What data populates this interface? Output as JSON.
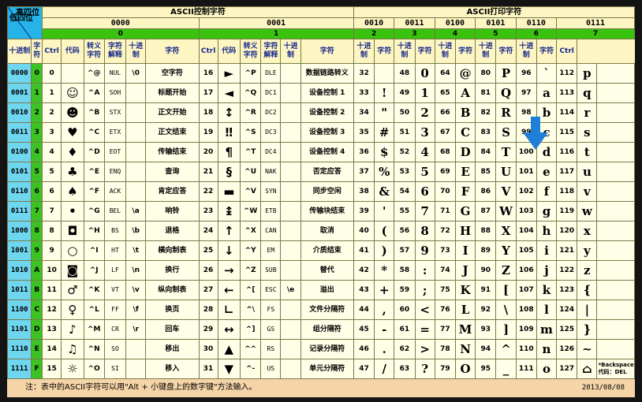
{
  "corner": {
    "top": "高四位",
    "bottom": "低四位"
  },
  "sections": {
    "control": "ASCII控制字符",
    "printable": "ASCII打印字符"
  },
  "high_bits": [
    "0000",
    "0001",
    "0010",
    "0011",
    "0100",
    "0101",
    "0110",
    "0111"
  ],
  "high_hex": [
    "0",
    "1",
    "2",
    "3",
    "4",
    "5",
    "6",
    "7"
  ],
  "col_headers": {
    "dec": "十进制",
    "char": "字符",
    "ctrl": "Ctrl",
    "code": "代码",
    "esc": "转义字符",
    "desc": "字符解释",
    "ctrl_last": "Ctrl"
  },
  "rows": [
    {
      "bin": "0000",
      "hex": "0",
      "c0": {
        "dec": "0",
        "glyph": "",
        "ctrl": "^@",
        "code": "NUL",
        "esc": "\\0",
        "desc": "空字符"
      },
      "c1": {
        "dec": "16",
        "glyph": "►",
        "ctrl": "^P",
        "code": "DLE",
        "esc": "",
        "desc": "数据链路转义"
      },
      "p": [
        {
          "dec": "32",
          "ch": ""
        },
        {
          "dec": "48",
          "ch": "0"
        },
        {
          "dec": "64",
          "ch": "@"
        },
        {
          "dec": "80",
          "ch": "P"
        },
        {
          "dec": "96",
          "ch": "`"
        },
        {
          "dec": "112",
          "ch": "p"
        }
      ]
    },
    {
      "bin": "0001",
      "hex": "1",
      "c0": {
        "dec": "1",
        "glyph": "☺",
        "ctrl": "^A",
        "code": "SOH",
        "esc": "",
        "desc": "标题开始"
      },
      "c1": {
        "dec": "17",
        "glyph": "◄",
        "ctrl": "^Q",
        "code": "DC1",
        "esc": "",
        "desc": "设备控制 1"
      },
      "p": [
        {
          "dec": "33",
          "ch": "!"
        },
        {
          "dec": "49",
          "ch": "1"
        },
        {
          "dec": "65",
          "ch": "A"
        },
        {
          "dec": "81",
          "ch": "Q"
        },
        {
          "dec": "97",
          "ch": "a"
        },
        {
          "dec": "113",
          "ch": "q"
        }
      ]
    },
    {
      "bin": "0010",
      "hex": "2",
      "c0": {
        "dec": "2",
        "glyph": "☻",
        "ctrl": "^B",
        "code": "STX",
        "esc": "",
        "desc": "正文开始"
      },
      "c1": {
        "dec": "18",
        "glyph": "↕",
        "ctrl": "^R",
        "code": "DC2",
        "esc": "",
        "desc": "设备控制 2"
      },
      "p": [
        {
          "dec": "34",
          "ch": "\""
        },
        {
          "dec": "50",
          "ch": "2"
        },
        {
          "dec": "66",
          "ch": "B"
        },
        {
          "dec": "82",
          "ch": "R"
        },
        {
          "dec": "98",
          "ch": "b"
        },
        {
          "dec": "114",
          "ch": "r"
        }
      ]
    },
    {
      "bin": "0011",
      "hex": "3",
      "c0": {
        "dec": "3",
        "glyph": "♥",
        "ctrl": "^C",
        "code": "ETX",
        "esc": "",
        "desc": "正文结束"
      },
      "c1": {
        "dec": "19",
        "glyph": "‼",
        "ctrl": "^S",
        "code": "DC3",
        "esc": "",
        "desc": "设备控制 3"
      },
      "p": [
        {
          "dec": "35",
          "ch": "#"
        },
        {
          "dec": "51",
          "ch": "3"
        },
        {
          "dec": "67",
          "ch": "C"
        },
        {
          "dec": "83",
          "ch": "S"
        },
        {
          "dec": "99",
          "ch": "c"
        },
        {
          "dec": "115",
          "ch": "s"
        }
      ]
    },
    {
      "bin": "0100",
      "hex": "4",
      "c0": {
        "dec": "4",
        "glyph": "♦",
        "ctrl": "^D",
        "code": "EOT",
        "esc": "",
        "desc": "传输结束"
      },
      "c1": {
        "dec": "20",
        "glyph": "¶",
        "ctrl": "^T",
        "code": "DC4",
        "esc": "",
        "desc": "设备控制 4"
      },
      "p": [
        {
          "dec": "36",
          "ch": "$"
        },
        {
          "dec": "52",
          "ch": "4"
        },
        {
          "dec": "68",
          "ch": "D"
        },
        {
          "dec": "84",
          "ch": "T"
        },
        {
          "dec": "100",
          "ch": "d"
        },
        {
          "dec": "116",
          "ch": "t"
        }
      ]
    },
    {
      "bin": "0101",
      "hex": "5",
      "c0": {
        "dec": "5",
        "glyph": "♣",
        "ctrl": "^E",
        "code": "ENQ",
        "esc": "",
        "desc": "查询"
      },
      "c1": {
        "dec": "21",
        "glyph": "§",
        "ctrl": "^U",
        "code": "NAK",
        "esc": "",
        "desc": "否定应答"
      },
      "p": [
        {
          "dec": "37",
          "ch": "%"
        },
        {
          "dec": "53",
          "ch": "5"
        },
        {
          "dec": "69",
          "ch": "E"
        },
        {
          "dec": "85",
          "ch": "U"
        },
        {
          "dec": "101",
          "ch": "e"
        },
        {
          "dec": "117",
          "ch": "u"
        }
      ]
    },
    {
      "bin": "0110",
      "hex": "6",
      "c0": {
        "dec": "6",
        "glyph": "♠",
        "ctrl": "^F",
        "code": "ACK",
        "esc": "",
        "desc": "肯定应答"
      },
      "c1": {
        "dec": "22",
        "glyph": "▬",
        "ctrl": "^V",
        "code": "SYN",
        "esc": "",
        "desc": "同步空闲"
      },
      "p": [
        {
          "dec": "38",
          "ch": "&"
        },
        {
          "dec": "54",
          "ch": "6"
        },
        {
          "dec": "70",
          "ch": "F"
        },
        {
          "dec": "86",
          "ch": "V"
        },
        {
          "dec": "102",
          "ch": "f"
        },
        {
          "dec": "118",
          "ch": "v"
        }
      ]
    },
    {
      "bin": "0111",
      "hex": "7",
      "c0": {
        "dec": "7",
        "glyph": "•",
        "ctrl": "^G",
        "code": "BEL",
        "esc": "\\a",
        "desc": "响铃"
      },
      "c1": {
        "dec": "23",
        "glyph": "↨",
        "ctrl": "^W",
        "code": "ETB",
        "esc": "",
        "desc": "传输块结束"
      },
      "p": [
        {
          "dec": "39",
          "ch": "'"
        },
        {
          "dec": "55",
          "ch": "7"
        },
        {
          "dec": "71",
          "ch": "G"
        },
        {
          "dec": "87",
          "ch": "W"
        },
        {
          "dec": "103",
          "ch": "g"
        },
        {
          "dec": "119",
          "ch": "w"
        }
      ]
    },
    {
      "bin": "1000",
      "hex": "8",
      "c0": {
        "dec": "8",
        "glyph": "◘",
        "ctrl": "^H",
        "code": "BS",
        "esc": "\\b",
        "desc": "退格"
      },
      "c1": {
        "dec": "24",
        "glyph": "↑",
        "ctrl": "^X",
        "code": "CAN",
        "esc": "",
        "desc": "取消"
      },
      "p": [
        {
          "dec": "40",
          "ch": "("
        },
        {
          "dec": "56",
          "ch": "8"
        },
        {
          "dec": "72",
          "ch": "H"
        },
        {
          "dec": "88",
          "ch": "X"
        },
        {
          "dec": "104",
          "ch": "h"
        },
        {
          "dec": "120",
          "ch": "x"
        }
      ]
    },
    {
      "bin": "1001",
      "hex": "9",
      "c0": {
        "dec": "9",
        "glyph": "○",
        "ctrl": "^I",
        "code": "HT",
        "esc": "\\t",
        "desc": "横向制表"
      },
      "c1": {
        "dec": "25",
        "glyph": "↓",
        "ctrl": "^Y",
        "code": "EM",
        "esc": "",
        "desc": "介质结束"
      },
      "p": [
        {
          "dec": "41",
          "ch": ")"
        },
        {
          "dec": "57",
          "ch": "9"
        },
        {
          "dec": "73",
          "ch": "I"
        },
        {
          "dec": "89",
          "ch": "Y"
        },
        {
          "dec": "105",
          "ch": "i"
        },
        {
          "dec": "121",
          "ch": "y"
        }
      ]
    },
    {
      "bin": "1010",
      "hex": "A",
      "c0": {
        "dec": "10",
        "glyph": "◙",
        "ctrl": "^J",
        "code": "LF",
        "esc": "\\n",
        "desc": "换行"
      },
      "c1": {
        "dec": "26",
        "glyph": "→",
        "ctrl": "^Z",
        "code": "SUB",
        "esc": "",
        "desc": "替代"
      },
      "p": [
        {
          "dec": "42",
          "ch": "*"
        },
        {
          "dec": "58",
          "ch": ":"
        },
        {
          "dec": "74",
          "ch": "J"
        },
        {
          "dec": "90",
          "ch": "Z"
        },
        {
          "dec": "106",
          "ch": "j"
        },
        {
          "dec": "122",
          "ch": "z"
        }
      ]
    },
    {
      "bin": "1011",
      "hex": "B",
      "c0": {
        "dec": "11",
        "glyph": "♂",
        "ctrl": "^K",
        "code": "VT",
        "esc": "\\v",
        "desc": "纵向制表"
      },
      "c1": {
        "dec": "27",
        "glyph": "←",
        "ctrl": "^[",
        "code": "ESC",
        "esc": "\\e",
        "desc": "溢出"
      },
      "p": [
        {
          "dec": "43",
          "ch": "+"
        },
        {
          "dec": "59",
          "ch": ";"
        },
        {
          "dec": "75",
          "ch": "K"
        },
        {
          "dec": "91",
          "ch": "["
        },
        {
          "dec": "107",
          "ch": "k"
        },
        {
          "dec": "123",
          "ch": "{"
        }
      ]
    },
    {
      "bin": "1100",
      "hex": "C",
      "c0": {
        "dec": "12",
        "glyph": "♀",
        "ctrl": "^L",
        "code": "FF",
        "esc": "\\f",
        "desc": "换页"
      },
      "c1": {
        "dec": "28",
        "glyph": "∟",
        "ctrl": "^\\",
        "code": "FS",
        "esc": "",
        "desc": "文件分隔符"
      },
      "p": [
        {
          "dec": "44",
          "ch": ","
        },
        {
          "dec": "60",
          "ch": "<"
        },
        {
          "dec": "76",
          "ch": "L"
        },
        {
          "dec": "92",
          "ch": "\\"
        },
        {
          "dec": "108",
          "ch": "l"
        },
        {
          "dec": "124",
          "ch": "|"
        }
      ]
    },
    {
      "bin": "1101",
      "hex": "D",
      "c0": {
        "dec": "13",
        "glyph": "♪",
        "ctrl": "^M",
        "code": "CR",
        "esc": "\\r",
        "desc": "回车"
      },
      "c1": {
        "dec": "29",
        "glyph": "↔",
        "ctrl": "^]",
        "code": "GS",
        "esc": "",
        "desc": "组分隔符"
      },
      "p": [
        {
          "dec": "45",
          "ch": "-"
        },
        {
          "dec": "61",
          "ch": "="
        },
        {
          "dec": "77",
          "ch": "M"
        },
        {
          "dec": "93",
          "ch": "]"
        },
        {
          "dec": "109",
          "ch": "m"
        },
        {
          "dec": "125",
          "ch": "}"
        }
      ]
    },
    {
      "bin": "1110",
      "hex": "E",
      "c0": {
        "dec": "14",
        "glyph": "♫",
        "ctrl": "^N",
        "code": "SO",
        "esc": "",
        "desc": "移出"
      },
      "c1": {
        "dec": "30",
        "glyph": "▲",
        "ctrl": "^^",
        "code": "RS",
        "esc": "",
        "desc": "记录分隔符"
      },
      "p": [
        {
          "dec": "46",
          "ch": "."
        },
        {
          "dec": "62",
          "ch": ">"
        },
        {
          "dec": "78",
          "ch": "N"
        },
        {
          "dec": "94",
          "ch": "^"
        },
        {
          "dec": "110",
          "ch": "n"
        },
        {
          "dec": "126",
          "ch": "~"
        }
      ]
    },
    {
      "bin": "1111",
      "hex": "F",
      "c0": {
        "dec": "15",
        "glyph": "☼",
        "ctrl": "^O",
        "code": "SI",
        "esc": "",
        "desc": "移入"
      },
      "c1": {
        "dec": "31",
        "glyph": "▼",
        "ctrl": "^-",
        "code": "US",
        "esc": "",
        "desc": "单元分隔符"
      },
      "p": [
        {
          "dec": "47",
          "ch": "/"
        },
        {
          "dec": "63",
          "ch": "?"
        },
        {
          "dec": "79",
          "ch": "O"
        },
        {
          "dec": "95",
          "ch": "_"
        },
        {
          "dec": "111",
          "ch": "o"
        },
        {
          "dec": "127",
          "ch": "⌂"
        }
      ]
    }
  ],
  "backspace_note": "*Backspace 代码：DEL",
  "footer_note": "注：表中的ASCII字符可以用\"Alt + 小键盘上的数字键\"方法输入。",
  "date": "2013/08/08",
  "colors": {
    "corner": "#26b4e8",
    "green": "#39c20e",
    "row_blue": "#6fd6f0",
    "cell": "#ffffe8",
    "footer": "#f5d4a8",
    "arrow": "#1f7fd8"
  },
  "arrow_icon": "arrow-down-icon"
}
